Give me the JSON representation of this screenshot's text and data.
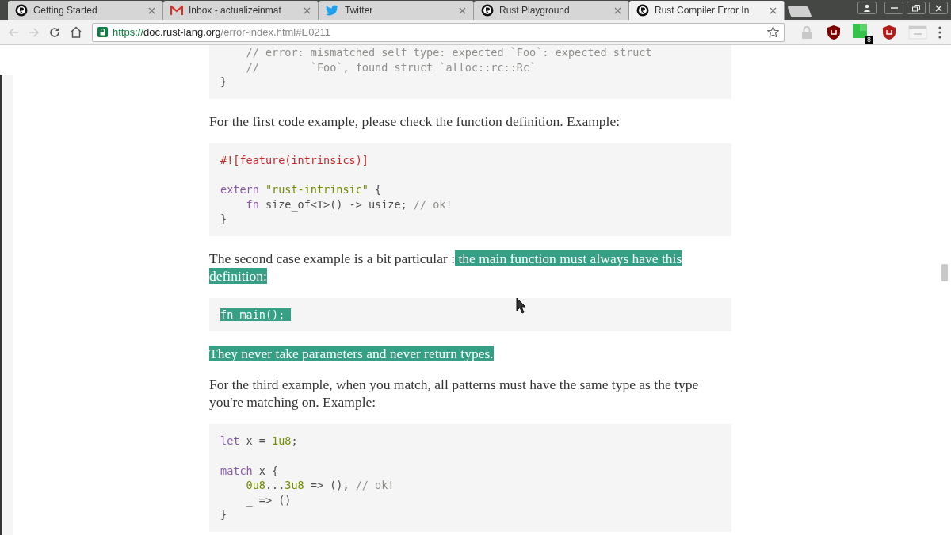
{
  "tabs": [
    {
      "title": "Getting Started",
      "kind": "rust",
      "selected": false
    },
    {
      "title": "Inbox - actualizeinmat",
      "kind": "mail",
      "selected": false
    },
    {
      "title": "Twitter",
      "kind": "bird",
      "selected": false
    },
    {
      "title": "Rust Playground",
      "kind": "rust",
      "selected": false
    },
    {
      "title": "Rust Compiler Error In",
      "kind": "rust",
      "selected": true
    }
  ],
  "address": {
    "scheme": "https://",
    "host": "doc.rust-lang.org",
    "path": "/error-index.html#E0211"
  },
  "extensions": [
    {
      "kind": "lock"
    },
    {
      "kind": "shield-ub"
    },
    {
      "kind": "green",
      "badge": "8"
    },
    {
      "kind": "shield-ws"
    },
    {
      "kind": "card"
    }
  ],
  "content": [
    {
      "kind": "code",
      "lines": [
        {
          "indented": true,
          "tokens": [
            {
              "kind": "comment",
              "text": "// error: mismatched self type: expected `Foo`: expected struct"
            }
          ]
        },
        {
          "indented": true,
          "tokens": [
            {
              "kind": "comment",
              "text": "//        `Foo`, found struct `alloc::rc::Rc`"
            }
          ]
        },
        {
          "indented": false,
          "tokens": [
            {
              "kind": "plain",
              "text": "}"
            }
          ]
        }
      ]
    },
    {
      "kind": "paragraph",
      "segments": [
        {
          "text": "For the first code example, please check the function definition. Example:",
          "highlighted": false
        }
      ]
    },
    {
      "kind": "code",
      "lines": [
        {
          "indented": false,
          "tokens": [
            {
              "kind": "attribute",
              "text": "#![feature(intrinsics)]"
            }
          ]
        },
        {
          "kind": "blank"
        },
        {
          "indented": false,
          "tokens": [
            {
              "kind": "keyword",
              "text": "extern "
            },
            {
              "kind": "string",
              "text": "\"rust-intrinsic\""
            },
            {
              "kind": "plain",
              "text": " {"
            }
          ]
        },
        {
          "indented": true,
          "tokens": [
            {
              "kind": "keyword",
              "text": "fn"
            },
            {
              "kind": "plain",
              "text": " size_of<T>() -> usize; "
            },
            {
              "kind": "comment",
              "text": "// ok!"
            }
          ]
        },
        {
          "indented": false,
          "tokens": [
            {
              "kind": "plain",
              "text": "}"
            }
          ]
        }
      ]
    },
    {
      "kind": "paragraph",
      "segments": [
        {
          "text": "The second case example is a bit particular :",
          "highlighted": false
        },
        {
          "text": " the main function must always have this definition:",
          "highlighted": true
        }
      ]
    },
    {
      "kind": "code",
      "highlighted": true,
      "lines": [
        {
          "indented": false,
          "tokens": [
            {
              "kind": "keyword",
              "text": "fn"
            },
            {
              "kind": "plain",
              "text": " main(); "
            }
          ]
        }
      ]
    },
    {
      "kind": "paragraph",
      "segments": [
        {
          "text": "They never take parameters and never return types.",
          "highlighted": true
        }
      ]
    },
    {
      "kind": "paragraph",
      "segments": [
        {
          "text": "For the third example, when you match, all patterns must have the same type as the type you're matching on. Example:",
          "highlighted": false
        }
      ]
    },
    {
      "kind": "code",
      "lines": [
        {
          "indented": false,
          "tokens": [
            {
              "kind": "keyword",
              "text": "let"
            },
            {
              "kind": "plain",
              "text": " x = "
            },
            {
              "kind": "number",
              "text": "1u8"
            },
            {
              "kind": "plain",
              "text": ";"
            }
          ]
        },
        {
          "kind": "blank"
        },
        {
          "indented": false,
          "tokens": [
            {
              "kind": "keyword",
              "text": "match"
            },
            {
              "kind": "plain",
              "text": " x {"
            }
          ]
        },
        {
          "indented": true,
          "tokens": [
            {
              "kind": "number",
              "text": "0u8"
            },
            {
              "kind": "plain",
              "text": "..."
            },
            {
              "kind": "number",
              "text": "3u8"
            },
            {
              "kind": "plain",
              "text": " => (), "
            },
            {
              "kind": "comment",
              "text": "// ok!"
            }
          ]
        },
        {
          "indented": true,
          "tokens": [
            {
              "kind": "plain",
              "text": "_ => ()"
            }
          ]
        },
        {
          "indented": false,
          "tokens": [
            {
              "kind": "plain",
              "text": "}"
            }
          ]
        }
      ]
    }
  ]
}
